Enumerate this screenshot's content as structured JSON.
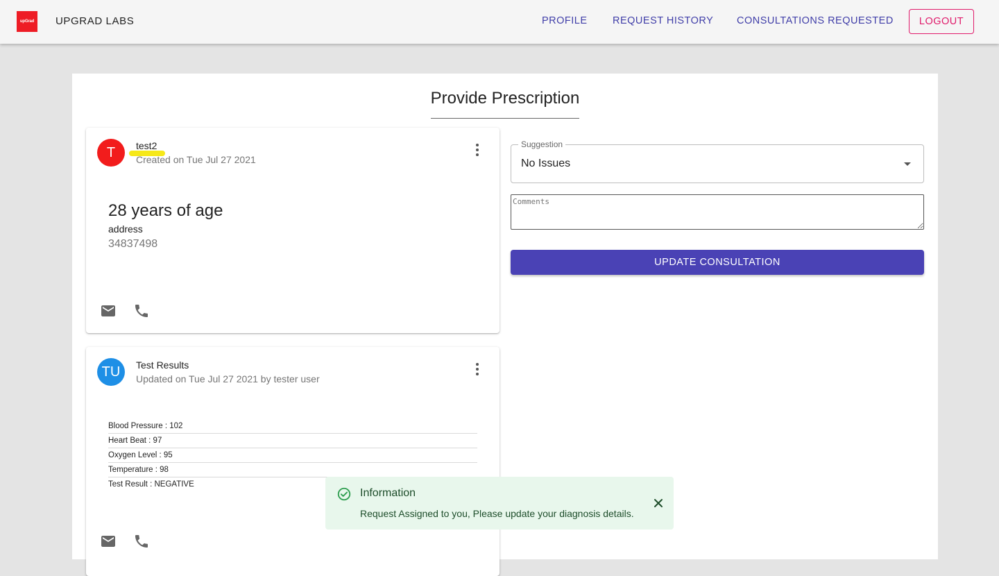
{
  "header": {
    "logo_text": "upGrad",
    "brand": "UPGRAD LABS",
    "nav": [
      "PROFILE",
      "REQUEST HISTORY",
      "CONSULTATIONS REQUESTED"
    ],
    "logout": "LOGOUT"
  },
  "page": {
    "title": "Provide Prescription"
  },
  "patient_card": {
    "avatar_letter": "T",
    "name": "test2",
    "created": "Created on Tue Jul 27 2021",
    "age": "28 years of age",
    "address": "address",
    "phone": "34837498"
  },
  "results_card": {
    "avatar_letters": "TU",
    "title": "Test Results",
    "updated": "Updated on Tue Jul 27 2021 by tester user",
    "rows": [
      "Blood Pressure : 102",
      "Heart Beat : 97",
      "Oxygen Level : 95",
      "Temperature : 98",
      "Test Result : NEGATIVE"
    ]
  },
  "form": {
    "suggestion_label": "Suggestion",
    "suggestion_value": "No Issues",
    "comments_placeholder": "Comments",
    "update_button": "UPDATE CONSULTATION"
  },
  "toast": {
    "title": "Information",
    "message": "Request Assigned to you, Please update your diagnosis details."
  },
  "colors": {
    "nav_link": "#3f3da8",
    "logout": "#e0196a",
    "primary_button": "#4a42b5",
    "avatar_patient": "#f21c1c",
    "avatar_results": "#1e8fe6",
    "toast_bg": "#e8f7ec",
    "success": "#2e9e4f"
  }
}
